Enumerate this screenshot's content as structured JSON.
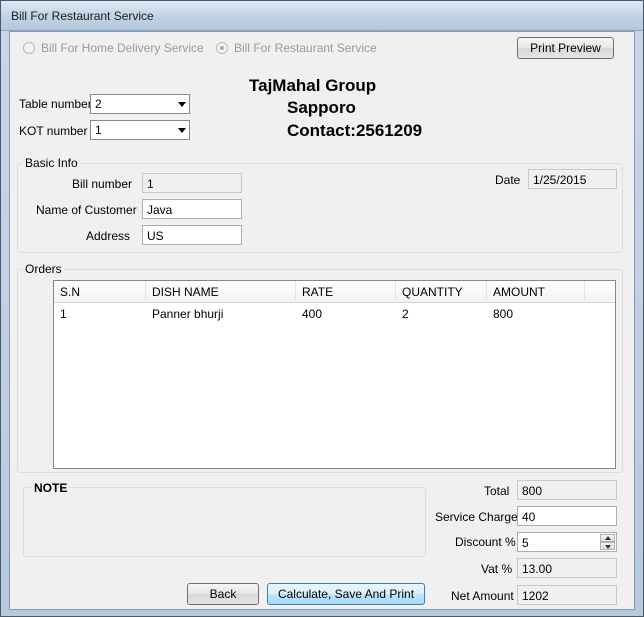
{
  "window": {
    "title": "Bill For Restaurant Service"
  },
  "service_type": {
    "home_delivery_label": "Bill For Home Delivery Service",
    "restaurant_label": "Bill For Restaurant Service",
    "selected": "restaurant"
  },
  "toolbar": {
    "print_preview_label": "Print Preview"
  },
  "header": {
    "line1": "TajMahal Group",
    "line2": "Sapporo",
    "line3": "Contact:2561209"
  },
  "table_number": {
    "label": "Table number",
    "value": "2"
  },
  "kot_number": {
    "label": "KOT number",
    "value": "1"
  },
  "basic_info": {
    "title": "Basic Info",
    "bill_number_label": "Bill number",
    "bill_number_value": "1",
    "customer_label": "Name of Customer",
    "customer_value": "Java",
    "address_label": "Address",
    "address_value": "US",
    "date_label": "Date",
    "date_value": "1/25/2015"
  },
  "orders": {
    "title": "Orders",
    "columns": [
      "S.N",
      "DISH NAME",
      "RATE",
      "QUANTITY",
      "AMOUNT"
    ],
    "rows": [
      [
        "1",
        "Panner bhurji",
        "400",
        "2",
        "800"
      ]
    ]
  },
  "note": {
    "title": "NOTE"
  },
  "summary": {
    "total_label": "Total",
    "total_value": "800",
    "service_charge_label": "Service Charge",
    "service_charge_value": "40",
    "discount_label": "Discount %",
    "discount_value": "5",
    "vat_label": "Vat %",
    "vat_value": "13.00",
    "net_amount_label": "Net Amount",
    "net_amount_value": "1202"
  },
  "actions": {
    "back_label": "Back",
    "calculate_label": "Calculate, Save And Print"
  }
}
